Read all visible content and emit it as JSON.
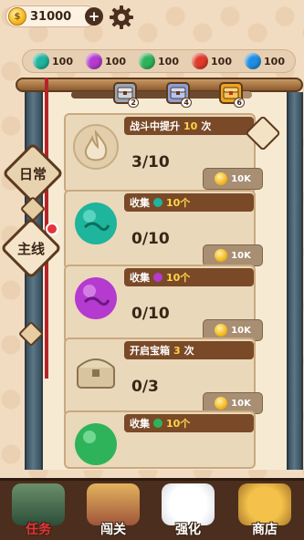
{
  "currency": {
    "coins": "31000"
  },
  "gems": [
    {
      "name": "teal-gem",
      "color": "#1fb49c",
      "amount": "100"
    },
    {
      "name": "purple-gem",
      "color": "#b43ad0",
      "amount": "100"
    },
    {
      "name": "green-gem",
      "color": "#2fb35a",
      "amount": "100"
    },
    {
      "name": "red-gem",
      "color": "#e23a2a",
      "amount": "100"
    },
    {
      "name": "blue-gem",
      "color": "#1f8ee0",
      "amount": "100"
    }
  ],
  "progress": {
    "level": 0.92,
    "chests": [
      {
        "name": "chest-2",
        "label": "2",
        "color": "#9aa6b8"
      },
      {
        "name": "chest-4",
        "label": "4",
        "color": "#8d9ed6"
      },
      {
        "name": "chest-6",
        "label": "6",
        "color": "#f0a31c"
      }
    ]
  },
  "tabs": {
    "daily": "日常",
    "main": "主线"
  },
  "tasks": [
    {
      "title": "战斗中提升",
      "count": "10",
      "unit": "次",
      "progress": "3/10",
      "reward": "10K",
      "icon": "flame-icon",
      "icon_color": "#d8c09c"
    },
    {
      "title": "收集",
      "count": "10个",
      "unit": "",
      "progress": "0/10",
      "reward": "10K",
      "icon": "teal-orb-icon",
      "icon_color": "#1fb49c"
    },
    {
      "title": "收集",
      "count": "10个",
      "unit": "",
      "progress": "0/10",
      "reward": "10K",
      "icon": "purple-orb-icon",
      "icon_color": "#b43ad0"
    },
    {
      "title": "开启宝箱",
      "count": "3",
      "unit": "次",
      "progress": "0/3",
      "reward": "10K",
      "icon": "treasure-chest-icon",
      "icon_color": "#c9b08c"
    },
    {
      "title": "收集",
      "count": "10个",
      "unit": "",
      "progress": "",
      "reward": "",
      "icon": "green-orb-icon",
      "icon_color": "#2fb35a"
    }
  ],
  "nav": [
    {
      "name": "nav-tasks",
      "label": "任务",
      "active": true
    },
    {
      "name": "nav-levels",
      "label": "闯关",
      "active": false
    },
    {
      "name": "nav-upgrade",
      "label": "强化",
      "active": false
    },
    {
      "name": "nav-shop",
      "label": "商店",
      "active": false
    }
  ]
}
